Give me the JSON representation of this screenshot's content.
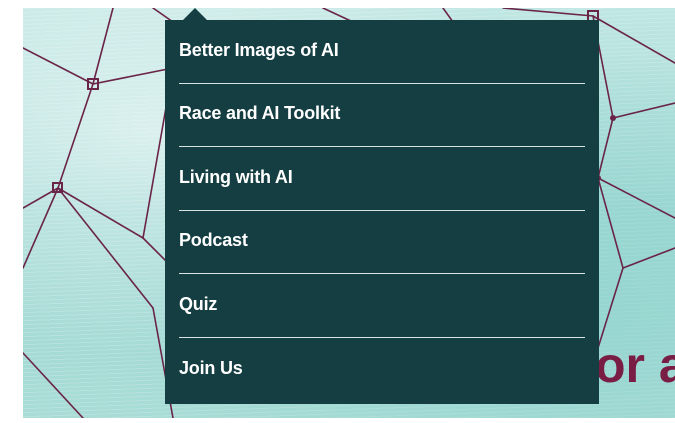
{
  "hero": {
    "headline_fragment": "or a",
    "colors": {
      "background": "#a6dcd6",
      "network_lines": "#6a2447",
      "headline": "#7a1d45"
    }
  },
  "dropdown": {
    "background_color": "#153e42",
    "text_color": "#ffffff",
    "items": [
      {
        "label": "Better Images of AI"
      },
      {
        "label": "Race and AI Toolkit"
      },
      {
        "label": "Living with AI"
      },
      {
        "label": "Podcast"
      },
      {
        "label": "Quiz"
      },
      {
        "label": "Join Us"
      }
    ]
  }
}
